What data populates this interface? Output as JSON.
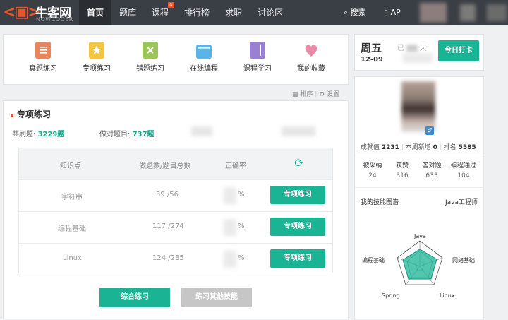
{
  "header": {
    "logo_cn": "牛客网",
    "logo_en": "NOWCODER",
    "nav": [
      {
        "label": "首页",
        "active": true
      },
      {
        "label": "题库",
        "active": false
      },
      {
        "label": "课程",
        "active": false,
        "badge": "N"
      },
      {
        "label": "排行榜",
        "active": false
      },
      {
        "label": "求职",
        "active": false
      },
      {
        "label": "讨论区",
        "active": false
      }
    ],
    "search_label": "搜索",
    "app_label": "AP"
  },
  "quick_links": [
    {
      "label": "真题练习",
      "icon": "document-icon",
      "color": "#e8855e"
    },
    {
      "label": "专项练习",
      "icon": "star-icon",
      "color": "#f2c640"
    },
    {
      "label": "错题练习",
      "icon": "error-doc-icon",
      "color": "#9cc65a"
    },
    {
      "label": "在线编程",
      "icon": "browser-icon",
      "color": "#5ab4e6"
    },
    {
      "label": "课程学习",
      "icon": "book-icon",
      "color": "#9a80d0"
    },
    {
      "label": "我的收藏",
      "icon": "heart-icon",
      "color": "#e88aa8"
    }
  ],
  "tools": {
    "sort": "排序",
    "settings": "设置"
  },
  "practice": {
    "title": "专项练习",
    "total_label": "共刷题:",
    "total_value": "3229题",
    "correct_label": "做对题目:",
    "correct_value": "737题",
    "headers": {
      "topic": "知识点",
      "count": "做题数/题目总数",
      "rate": "正确率"
    },
    "rows": [
      {
        "topic": "字符串",
        "count": "39 /56",
        "rate_suffix": "%",
        "button": "专项练习"
      },
      {
        "topic": "编程基础",
        "count": "117 /274",
        "rate_suffix": "%",
        "button": "专项练习"
      },
      {
        "topic": "Linux",
        "count": "124 /235",
        "rate_suffix": "%",
        "button": "专项练习"
      }
    ],
    "btn_comprehensive": "综合练习",
    "btn_other": "练习其他技能"
  },
  "checkin": {
    "weekday": "周五",
    "date": "12-09",
    "faint_text": "已",
    "faint_text2": "天",
    "button": "今日打卡"
  },
  "profile": {
    "score_label": "成就值",
    "score_value": "2231",
    "new_label": "本周新增",
    "new_value": "0",
    "rank_label": "排名",
    "rank_value": "5585",
    "counts": [
      {
        "label": "被采纳",
        "value": "24"
      },
      {
        "label": "获赞",
        "value": "316"
      },
      {
        "label": "答对题",
        "value": "633"
      },
      {
        "label": "编程通过",
        "value": "104"
      }
    ],
    "skill_title": "我的技能图谱",
    "skill_role": "Java工程师",
    "radar_labels": [
      "Java",
      "网络基础",
      "Linux",
      "Spring",
      "编程基础"
    ]
  }
}
